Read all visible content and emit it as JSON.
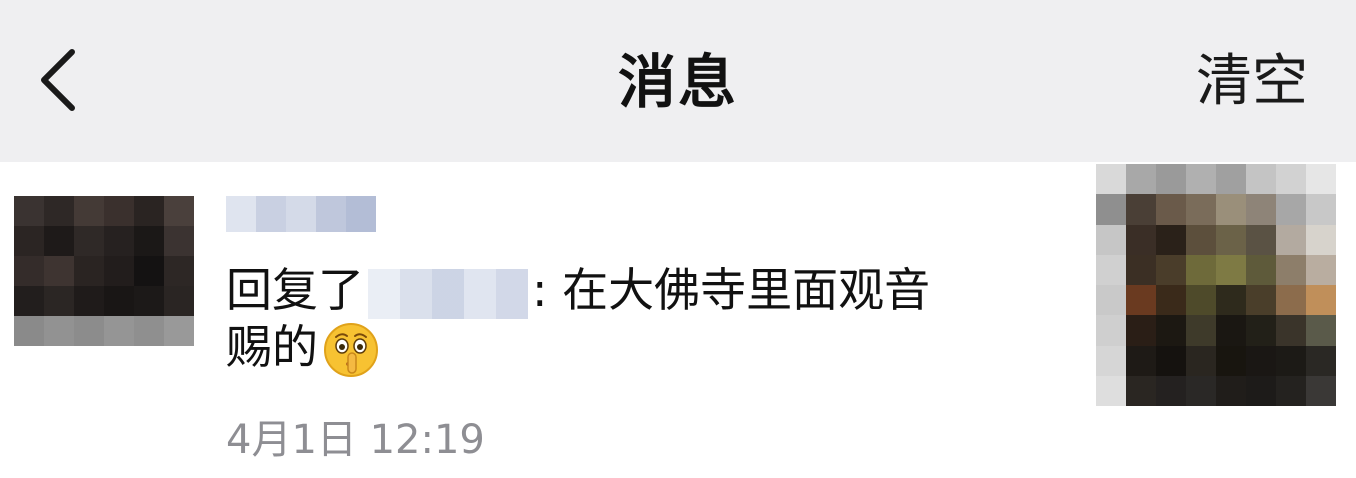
{
  "header": {
    "title": "消息",
    "clear_label": "清空",
    "back_icon": "chevron-left-icon",
    "background": "#efeff1"
  },
  "message": {
    "reply_prefix": "回复了",
    "reply_text": ": 在大佛寺里面观音",
    "reply_text_cont": "赐的",
    "emoji": "shushing-face-emoji",
    "timestamp": "4月1日 12:19",
    "avatar_icon": "pixelated-avatar",
    "thumbnail_icon": "pixelated-image-thumbnail",
    "timestamp_color": "#8e8e93"
  }
}
